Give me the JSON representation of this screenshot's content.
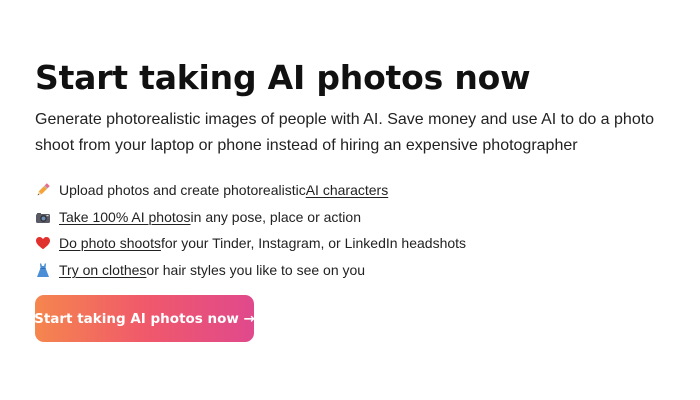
{
  "hero": {
    "title": "Start taking AI photos now",
    "subtitle": "Generate photorealistic images of people with AI. Save money and use AI to do a photo shoot from your laptop or phone instead of hiring an expensive photographer"
  },
  "features": [
    {
      "icon": "pencil-icon",
      "before": "Upload photos and create photorealistic ",
      "link": "AI characters",
      "after": ""
    },
    {
      "icon": "camera-icon",
      "before": "",
      "link": "Take 100% AI photos",
      "after": " in any pose, place or action"
    },
    {
      "icon": "heart-icon",
      "before": "",
      "link": "Do photo shoots",
      "after": " for your Tinder, Instagram, or LinkedIn headshots"
    },
    {
      "icon": "dress-icon",
      "before": "",
      "link": "Try on clothes",
      "after": " or hair styles you like to see on you"
    }
  ],
  "cta": {
    "label": "Start taking AI photos now →"
  },
  "colors": {
    "cta_gradient_start": "#f5864e",
    "cta_gradient_mid": "#f0596a",
    "cta_gradient_end": "#e0498c",
    "heart": "#e0312f",
    "dress": "#4a8fd6",
    "pencil": "#f2a33a"
  }
}
